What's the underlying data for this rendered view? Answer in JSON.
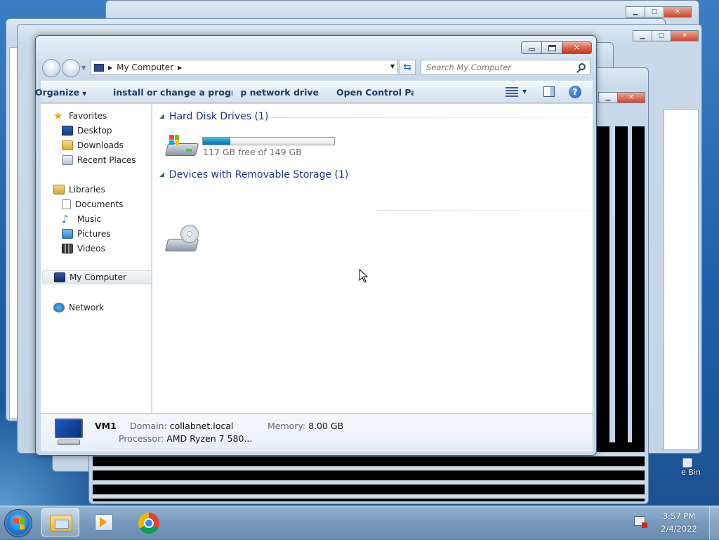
{
  "window": {
    "title": "My Computer",
    "controls": {
      "minimize": "minimize",
      "maximize": "maximize",
      "close": "close"
    }
  },
  "address": {
    "location": "My Computer"
  },
  "search": {
    "placeholder": "Search My Computer"
  },
  "toolbar": {
    "items": [
      {
        "label": "Organize"
      },
      {
        "label": "install or change a program"
      },
      {
        "label": "Map network drive"
      },
      {
        "label": "Open Control Panel"
      }
    ]
  },
  "nav": {
    "favorites": "Favorites",
    "desktop": "Desktop",
    "downloads": "Downloads",
    "recent": "Recent Places",
    "libraries": "Libraries",
    "documents": "Documents",
    "music": "Music",
    "pictures": "Pictures",
    "videos": "Videos",
    "computer": "My Computer",
    "network": "Network"
  },
  "content": {
    "hdd_group": "Hard Disk Drives (1)",
    "removable_group": "Devices with Removable Storage (1)",
    "drive": {
      "free_text": "117 GB free of 149 GB",
      "used_fraction": 0.21
    }
  },
  "details": {
    "name": "VM1",
    "domain_label": "Domain:",
    "domain_value": "collabnet.local",
    "memory_label": "Memory:",
    "memory_value": "8.00 GB",
    "processor_label": "Processor:",
    "processor_value": "AMD Ryzen 7 580..."
  },
  "desktop": {
    "recycle_label": "e Bin"
  },
  "taskbar": {
    "time": "3:57 PM",
    "date": "2/4/2022"
  },
  "colors": {
    "accent": "#1e3287",
    "progress": "#1a88b6",
    "close": "#c2381e"
  }
}
